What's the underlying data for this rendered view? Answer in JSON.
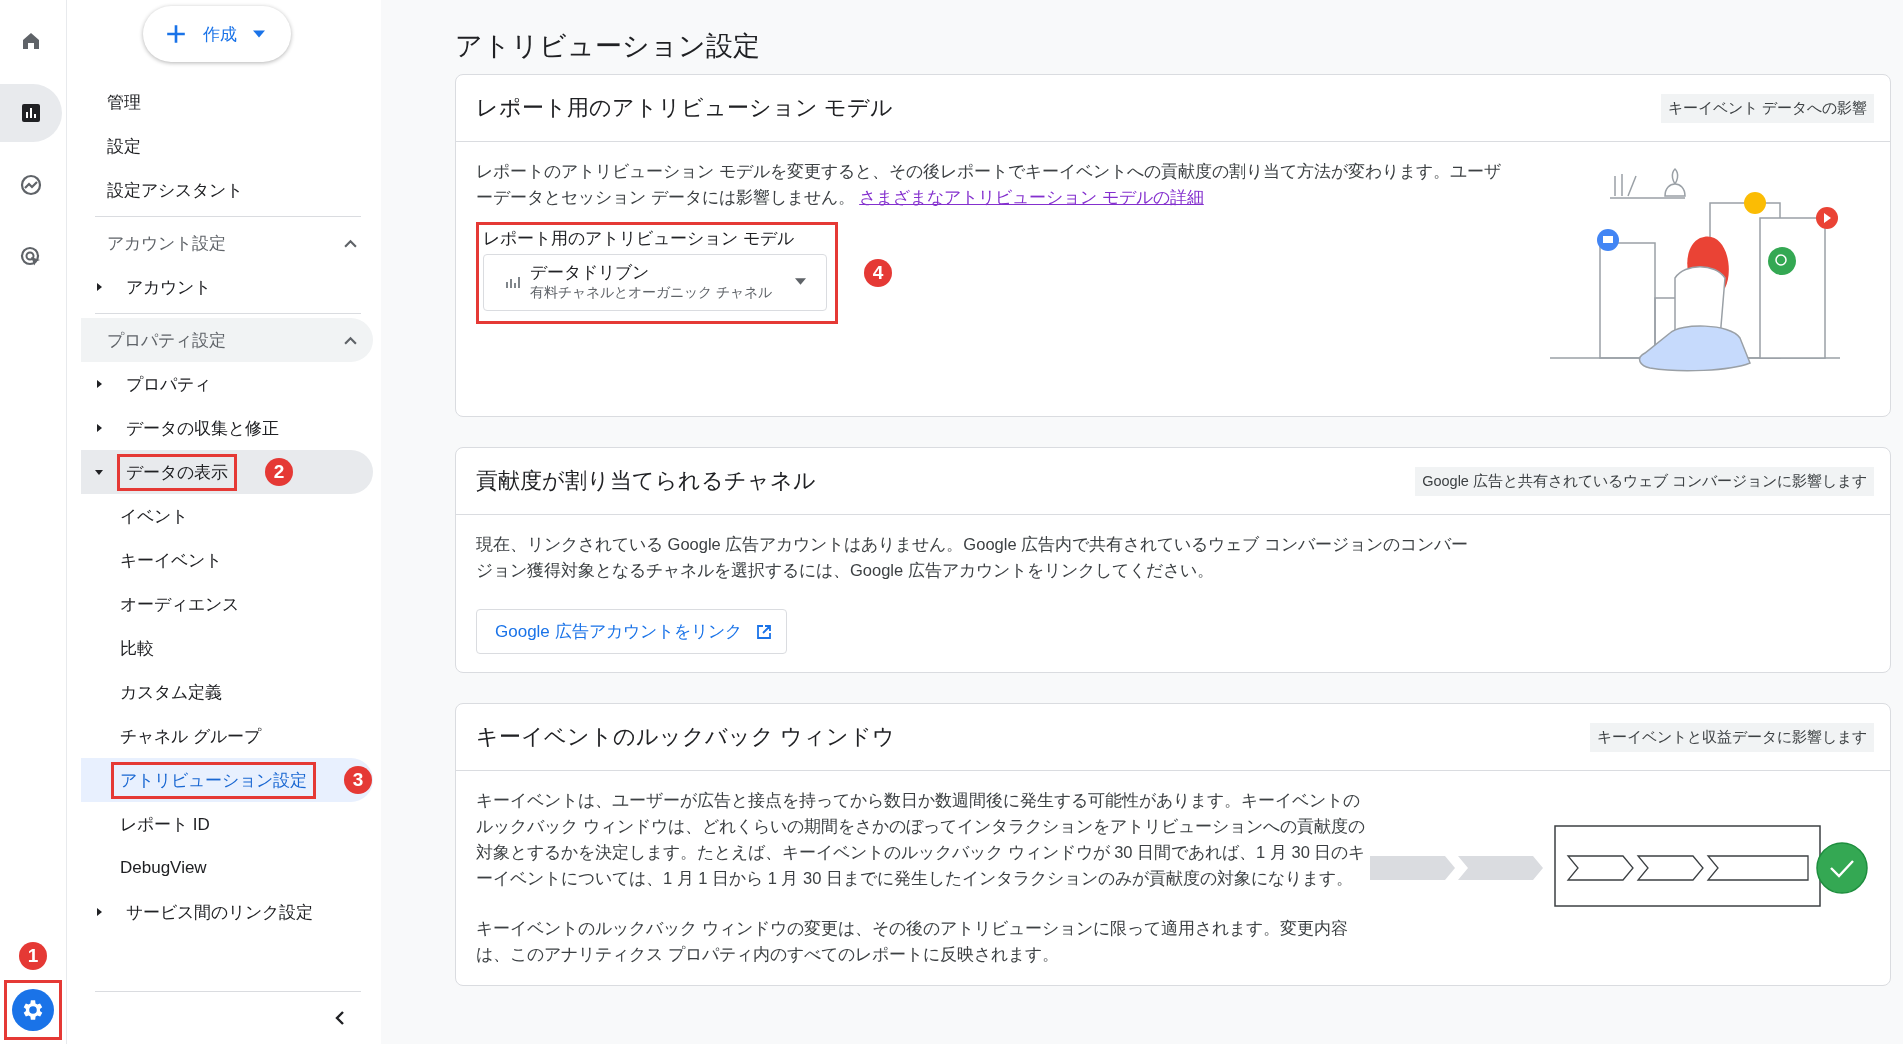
{
  "rail": {
    "items": [
      {
        "kind": "home",
        "selected": false
      },
      {
        "kind": "reports",
        "selected": true
      },
      {
        "kind": "explore",
        "selected": false
      },
      {
        "kind": "advertising",
        "selected": false
      }
    ],
    "settings": {
      "selected": true,
      "annotation": "1"
    }
  },
  "create_button": {
    "label": "作成"
  },
  "sidebar": {
    "top_items": [
      "管理",
      "設定",
      "設定アシスタント"
    ],
    "sections": [
      {
        "title": "アカウント設定",
        "expanded": true,
        "active": false,
        "items": [
          {
            "label": "アカウント",
            "expanded": false,
            "selected": false
          }
        ]
      },
      {
        "title": "プロパティ設定",
        "expanded": true,
        "active": true,
        "items": [
          {
            "label": "プロパティ",
            "expanded": false,
            "selected": false
          },
          {
            "label": "データの収集と修正",
            "expanded": false,
            "selected": false
          },
          {
            "label": "データの表示",
            "expanded": true,
            "selected": true,
            "annotation": "2",
            "children": [
              {
                "label": "イベント",
                "selected": false
              },
              {
                "label": "キーイベント",
                "selected": false
              },
              {
                "label": "オーディエンス",
                "selected": false
              },
              {
                "label": "比較",
                "selected": false
              },
              {
                "label": "カスタム定義",
                "selected": false
              },
              {
                "label": "チャネル グループ",
                "selected": false
              },
              {
                "label": "アトリビューション設定",
                "selected": true,
                "annotation": "3"
              },
              {
                "label": "レポート ID",
                "selected": false
              },
              {
                "label": "DebugView",
                "selected": false
              }
            ]
          },
          {
            "label": "サービス間のリンク設定",
            "expanded": false,
            "selected": false
          }
        ]
      }
    ]
  },
  "page_title": "アトリビューション設定",
  "cards": [
    {
      "kind": "model",
      "title": "レポート用のアトリビューション モデル",
      "tag": "キーイベント データへの影響",
      "description": "レポートのアトリビューション モデルを変更すると、その後レポートでキーイベントへの貢献度の割り当て方法が変わります。ユーザーデータとセッション データには影響しません。",
      "link": "さまざまなアトリビューション モデルの詳細",
      "field": {
        "label": "レポート用のアトリビューション モデル",
        "value": "データドリブン",
        "sublabel": "有料チャネルとオーガニック チャネル",
        "annotation": "4"
      }
    },
    {
      "kind": "channels",
      "title": "貢献度が割り当てられるチャネル",
      "tag": "Google 広告と共有されているウェブ コンバージョンに影響します",
      "description": "現在、リンクされている Google 広告アカウントはありません。Google 広告内で共有されているウェブ コンバージョンのコンバージョン獲得対象となるチャネルを選択するには、Google 広告アカウントをリンクしてください。",
      "button": "Google 広告アカウントをリンク"
    },
    {
      "kind": "lookback",
      "title": "キーイベントのルックバック ウィンドウ",
      "tag": "キーイベントと収益データに影響します",
      "paragraphs": [
        "キーイベントは、ユーザーが広告と接点を持ってから数日か数週間後に発生する可能性があります。キーイベントのルックバック ウィンドウは、どれくらいの期間をさかのぼってインタラクションをアトリビューションへの貢献度の対象とするかを決定します。たとえば、キーイベントのルックバック ウィンドウが 30 日間であれば、1 月 30 日のキーイベントについては、1 月 1 日から 1 月 30 日までに発生したインタラクションのみが貢献度の対象になります。",
        "キーイベントのルックバック ウィンドウの変更は、その後のアトリビューションに限って適用されます。変更内容は、このアナリティクス プロパティ内のすべてのレポートに反映されます。"
      ]
    }
  ]
}
